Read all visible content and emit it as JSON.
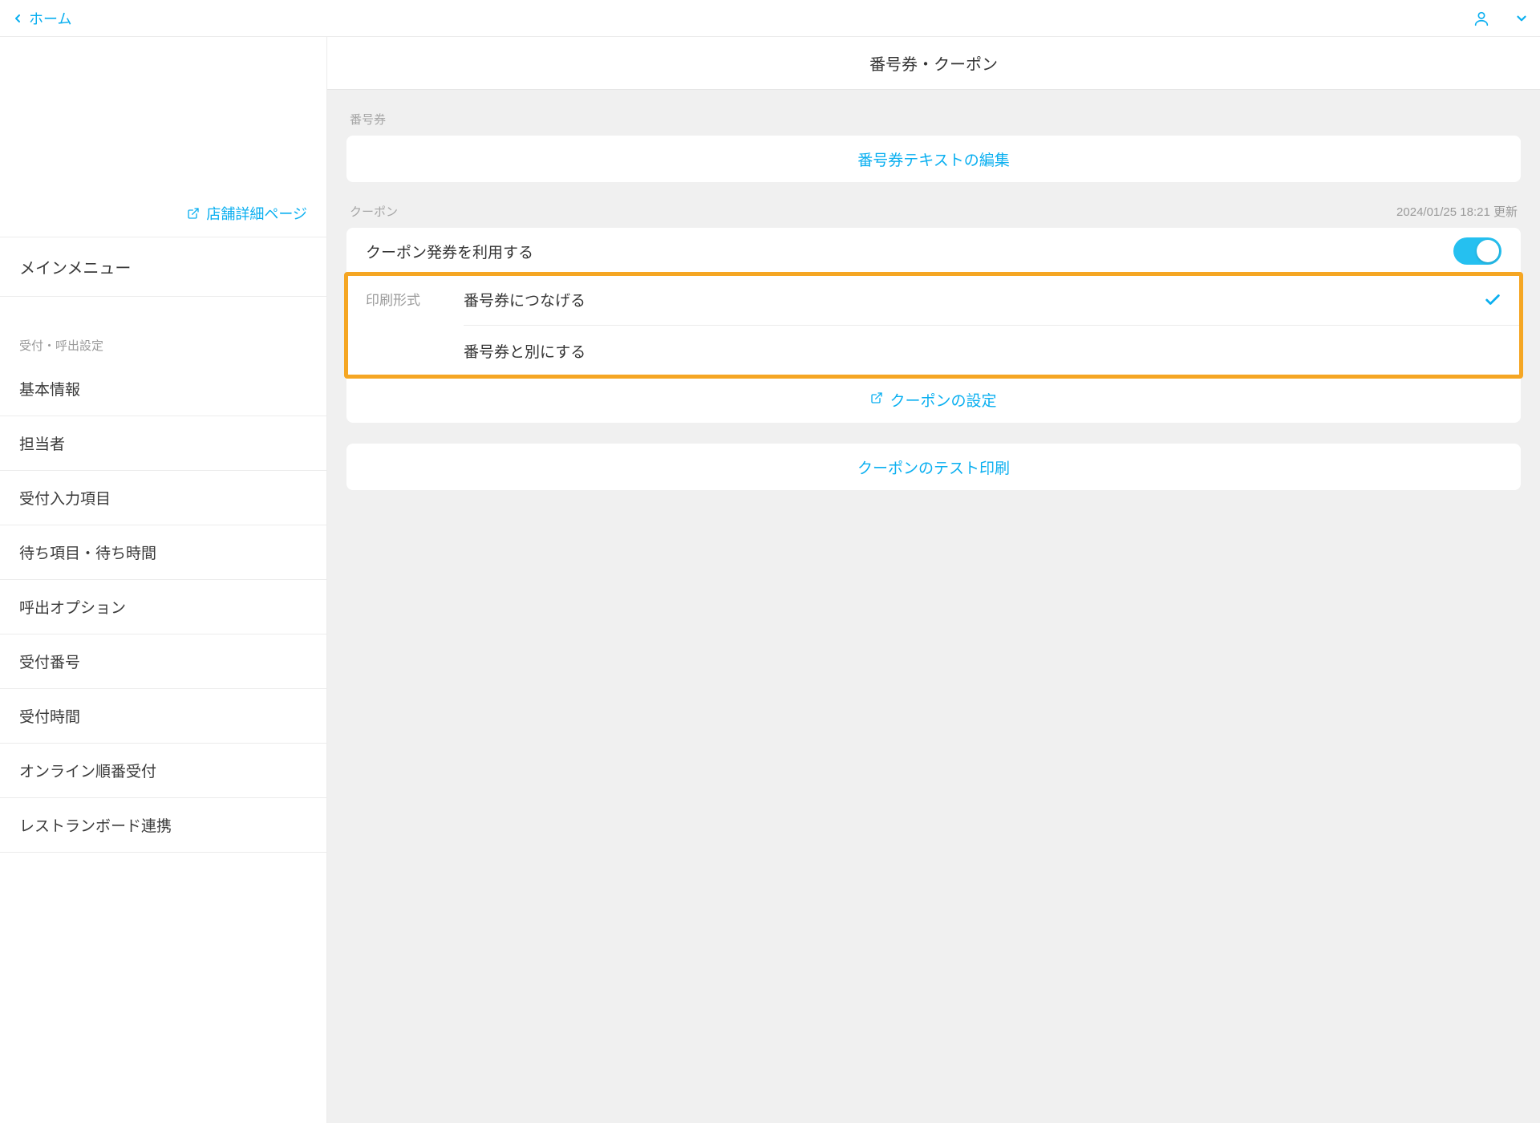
{
  "nav": {
    "home_label": "ホーム"
  },
  "sidebar": {
    "store_link": "店舗詳細ページ",
    "main_menu": "メインメニュー",
    "section_title": "受付・呼出設定",
    "items": [
      {
        "label": "基本情報"
      },
      {
        "label": "担当者"
      },
      {
        "label": "受付入力項目"
      },
      {
        "label": "待ち項目・待ち時間"
      },
      {
        "label": "呼出オプション"
      },
      {
        "label": "受付番号"
      },
      {
        "label": "受付時間"
      },
      {
        "label": "オンライン順番受付"
      },
      {
        "label": "レストランボード連携"
      }
    ]
  },
  "main": {
    "title": "番号券・クーポン",
    "ticket_section": "番号券",
    "ticket_edit": "番号券テキストの編集",
    "coupon_section": "クーポン",
    "coupon_updated": "2024/01/25 18:21 更新",
    "coupon_toggle_label": "クーポン発券を利用する",
    "print_format_label": "印刷形式",
    "print_options": [
      {
        "label": "番号券につなげる",
        "selected": true
      },
      {
        "label": "番号券と別にする",
        "selected": false
      }
    ],
    "coupon_settings": "クーポンの設定",
    "coupon_test_print": "クーポンのテスト印刷"
  }
}
